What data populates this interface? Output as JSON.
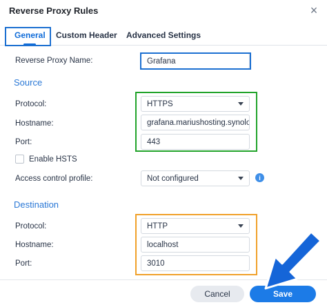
{
  "dialog": {
    "title": "Reverse Proxy Rules"
  },
  "tabs": [
    {
      "label": "General"
    },
    {
      "label": "Custom Header"
    },
    {
      "label": "Advanced Settings"
    }
  ],
  "general": {
    "name_label": "Reverse Proxy Name:",
    "name_value": "Grafana"
  },
  "source": {
    "heading": "Source",
    "protocol_label": "Protocol:",
    "protocol_value": "HTTPS",
    "hostname_label": "Hostname:",
    "hostname_value": "grafana.mariushosting.synology.me",
    "port_label": "Port:",
    "port_value": "443",
    "hsts_label": "Enable HSTS",
    "hsts_checked": false,
    "acl_label": "Access control profile:",
    "acl_value": "Not configured",
    "info_glyph": "i"
  },
  "destination": {
    "heading": "Destination",
    "protocol_label": "Protocol:",
    "protocol_value": "HTTP",
    "hostname_label": "Hostname:",
    "hostname_value": "localhost",
    "port_label": "Port:",
    "port_value": "3010"
  },
  "buttons": {
    "cancel": "Cancel",
    "save": "Save"
  },
  "icons": {
    "close": "×"
  },
  "colors": {
    "accent": "#1c7be7",
    "section_heading": "#2a78d6",
    "highlight_blue": "#1b6fd1",
    "highlight_green": "#21a32a",
    "highlight_orange": "#f0a029",
    "arrow": "#1565d8"
  }
}
